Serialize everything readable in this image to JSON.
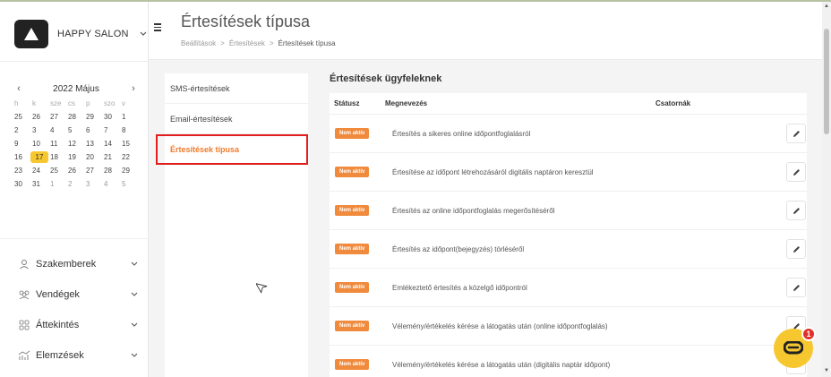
{
  "brand": {
    "name": "HAPPY SALON",
    "icon": "chevron-down-icon"
  },
  "header": {
    "title": "Értesítések típusa",
    "breadcrumb": [
      "Beállítások",
      ">",
      "Értesítések",
      ">",
      "Értesítések típusa"
    ]
  },
  "calendar": {
    "month_label": "2022 Május",
    "prev": "‹",
    "next": "›",
    "weekdays": [
      "h",
      "k",
      "sze",
      "cs",
      "p",
      "szo",
      "v"
    ],
    "days": [
      {
        "d": "25",
        "muted": false
      },
      {
        "d": "26",
        "muted": false
      },
      {
        "d": "27",
        "muted": false
      },
      {
        "d": "28",
        "muted": false
      },
      {
        "d": "29",
        "muted": false
      },
      {
        "d": "30",
        "muted": false
      },
      {
        "d": "1",
        "muted": false
      },
      {
        "d": "2",
        "muted": false
      },
      {
        "d": "3",
        "muted": false
      },
      {
        "d": "4",
        "muted": false
      },
      {
        "d": "5",
        "muted": false
      },
      {
        "d": "6",
        "muted": false
      },
      {
        "d": "7",
        "muted": false
      },
      {
        "d": "8",
        "muted": false
      },
      {
        "d": "9",
        "muted": false
      },
      {
        "d": "10",
        "muted": false
      },
      {
        "d": "11",
        "muted": false
      },
      {
        "d": "12",
        "muted": false
      },
      {
        "d": "13",
        "muted": false
      },
      {
        "d": "14",
        "muted": false
      },
      {
        "d": "15",
        "muted": false
      },
      {
        "d": "16",
        "muted": false
      },
      {
        "d": "17",
        "muted": false,
        "today": true
      },
      {
        "d": "18",
        "muted": false
      },
      {
        "d": "19",
        "muted": false
      },
      {
        "d": "20",
        "muted": false
      },
      {
        "d": "21",
        "muted": false
      },
      {
        "d": "22",
        "muted": false
      },
      {
        "d": "23",
        "muted": false
      },
      {
        "d": "24",
        "muted": false
      },
      {
        "d": "25",
        "muted": false
      },
      {
        "d": "26",
        "muted": false
      },
      {
        "d": "27",
        "muted": false
      },
      {
        "d": "28",
        "muted": false
      },
      {
        "d": "29",
        "muted": false
      },
      {
        "d": "30",
        "muted": false
      },
      {
        "d": "31",
        "muted": false
      },
      {
        "d": "1",
        "muted": true
      },
      {
        "d": "2",
        "muted": true
      },
      {
        "d": "3",
        "muted": true
      },
      {
        "d": "4",
        "muted": true
      },
      {
        "d": "5",
        "muted": true
      }
    ],
    "highlight_color": "#f7c72f"
  },
  "nav": {
    "items": [
      {
        "label": "Szakemberek",
        "icon": "person-icon"
      },
      {
        "label": "Vendégek",
        "icon": "people-icon"
      },
      {
        "label": "Áttekintés",
        "icon": "grid-icon"
      },
      {
        "label": "Elemzések",
        "icon": "chart-icon"
      }
    ]
  },
  "submenu": {
    "items": [
      {
        "label": "SMS-értesítések",
        "active": false
      },
      {
        "label": "Email-értesítések",
        "active": false
      },
      {
        "label": "Értesítések típusa",
        "active": true
      }
    ],
    "active_color": "#f07b2c"
  },
  "panel": {
    "title": "Értesítések ügyfeleknek",
    "columns": [
      "Státusz",
      "Megnevezés",
      "Csatornák"
    ],
    "rows": [
      {
        "status": "Nem aktív",
        "name": "Értesítés a sikeres online időpontfoglalásról"
      },
      {
        "status": "Nem aktív",
        "name": "Értesítése az időpont létrehozásáról digitális naptáron keresztül"
      },
      {
        "status": "Nem aktív",
        "name": "Értesítés az online időpontfoglalás megerősítéséről"
      },
      {
        "status": "Nem aktív",
        "name": "Értesítés az időpont(bejegyzés) törléséről"
      },
      {
        "status": "Nem aktív",
        "name": "Emlékeztető értesítés a közelgő időpontról"
      },
      {
        "status": "Nem aktív",
        "name": "Vélemény/értékelés kérése a látogatás után (online időpontfoglalás)"
      },
      {
        "status": "Nem aktív",
        "name": "Vélemény/értékelés kérése a látogatás után (digitális naptár időpont)"
      }
    ],
    "badge_color": "#f08a3c"
  },
  "chat": {
    "badge_count": "1",
    "color": "#f7c72f"
  }
}
